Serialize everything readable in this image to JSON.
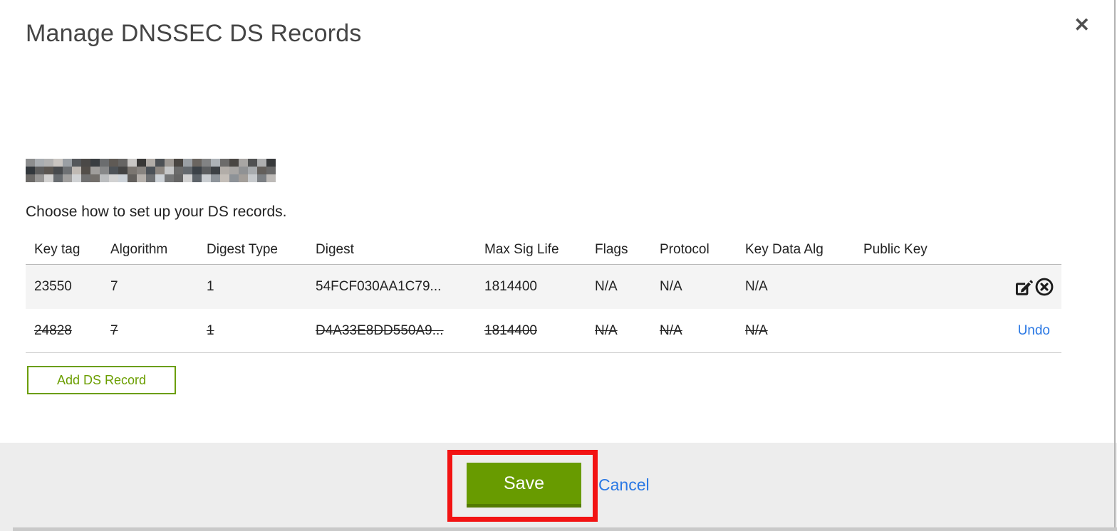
{
  "modal": {
    "title": "Manage DNSSEC DS Records",
    "close_icon": "✕",
    "domain_redacted": true,
    "subtitle": "Choose how to set up your DS records."
  },
  "table": {
    "columns": {
      "key_tag": "Key tag",
      "algorithm": "Algorithm",
      "digest_type": "Digest Type",
      "digest": "Digest",
      "max_sig_life": "Max Sig Life",
      "flags": "Flags",
      "protocol": "Protocol",
      "key_data_alg": "Key Data Alg",
      "public_key": "Public Key"
    },
    "rows": [
      {
        "key_tag": "23550",
        "algorithm": "7",
        "digest_type": "1",
        "digest": "54FCF030AA1C79...",
        "max_sig_life": "1814400",
        "flags": "N/A",
        "protocol": "N/A",
        "key_data_alg": "N/A",
        "public_key": "",
        "state": "normal"
      },
      {
        "key_tag": "24828",
        "algorithm": "7",
        "digest_type": "1",
        "digest": "D4A33E8DD550A9...",
        "max_sig_life": "1814400",
        "flags": "N/A",
        "protocol": "N/A",
        "key_data_alg": "N/A",
        "public_key": "",
        "state": "deleted",
        "undo_label": "Undo"
      }
    ]
  },
  "buttons": {
    "add_ds_record": "Add DS Record",
    "save": "Save",
    "cancel": "Cancel"
  },
  "colors": {
    "button_green": "#689b00",
    "button_green_dark": "#527a00",
    "outline_green": "#6b9e00",
    "link_blue": "#2a78e4",
    "annotation_red": "#f21313"
  }
}
